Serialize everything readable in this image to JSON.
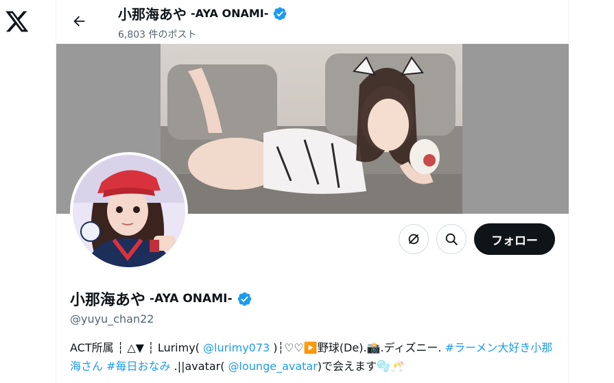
{
  "header": {
    "display_name": "小那海あや",
    "name_suffix": "-AYA ONAMI-",
    "post_count": "6,803 件のポスト"
  },
  "actions": {
    "follow_label": "フォロー"
  },
  "profile": {
    "display_name": "小那海あや",
    "name_suffix": "-AYA ONAMI-",
    "handle": "@yuyu_chan22",
    "bio": {
      "line1_a": "ACT所属 ┆ △▼ ┆ Lurimy( ",
      "line1_mention": "@lurimy073",
      "line1_b": " )┆♡♡▶️野球(De).📸.ディズニー. ",
      "line1_hashtag": "#ラーメン大好き小那海さん",
      "line2_sep": " ",
      "line2_hashtag": "#毎日おなみ",
      "line2_a": " .||avatar( ",
      "line2_mention": "@lounge_avatar",
      "line2_b": ")で会えます🫧🥂"
    }
  },
  "colors": {
    "accent": "#1d9bf0",
    "verified": "#1d9bf0",
    "follow_bg": "#0f1419",
    "banner_bg": "#999999"
  }
}
